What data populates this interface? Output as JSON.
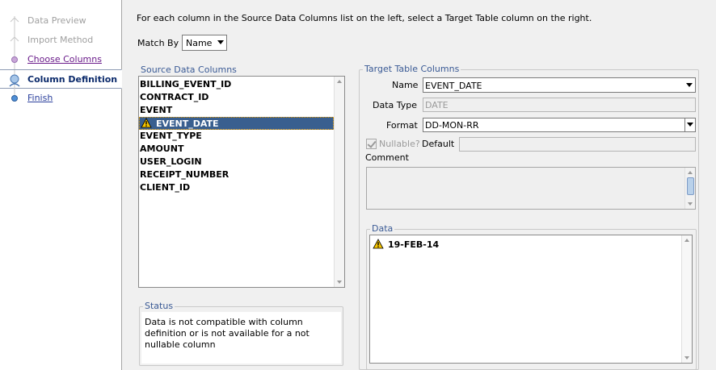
{
  "wizard": {
    "steps": [
      {
        "label": "Data Preview",
        "state": "disabled"
      },
      {
        "label": "Import Method",
        "state": "disabled"
      },
      {
        "label": "Choose Columns",
        "state": "visited"
      },
      {
        "label": "Column Definition",
        "state": "active"
      },
      {
        "label": "Finish",
        "state": "link"
      }
    ]
  },
  "instructions": "For each column in the Source Data Columns list on the left, select a Target Table column on the right.",
  "match_by": {
    "label": "Match By",
    "value": "Name"
  },
  "source": {
    "title": "Source Data Columns",
    "items": [
      {
        "label": "BILLING_EVENT_ID",
        "warning": false
      },
      {
        "label": "CONTRACT_ID",
        "warning": false
      },
      {
        "label": "EVENT",
        "warning": false
      },
      {
        "label": "EVENT_DATE",
        "warning": true,
        "selected": true
      },
      {
        "label": "EVENT_TYPE",
        "warning": false
      },
      {
        "label": "AMOUNT",
        "warning": false
      },
      {
        "label": "USER_LOGIN",
        "warning": false
      },
      {
        "label": "RECEIPT_NUMBER",
        "warning": false
      },
      {
        "label": "CLIENT_ID",
        "warning": false
      }
    ]
  },
  "status": {
    "title": "Status",
    "text": "Data is not compatible with column definition or is not available for a not nullable column"
  },
  "target": {
    "title": "Target Table Columns",
    "name_label": "Name",
    "name_value": "EVENT_DATE",
    "datatype_label": "Data Type",
    "datatype_value": "DATE",
    "format_label": "Format",
    "format_value": "DD-MON-RR",
    "nullable_label": "Nullable?",
    "nullable_checked": true,
    "default_label": "Default",
    "default_value": "",
    "comment_label": "Comment",
    "comment_value": ""
  },
  "data": {
    "title": "Data",
    "rows": [
      {
        "value": "19-FEB-14",
        "warning": true
      }
    ]
  },
  "colors": {
    "selection": "#395f8f",
    "group_title": "#3a5a95",
    "warning": "#f5c400"
  }
}
